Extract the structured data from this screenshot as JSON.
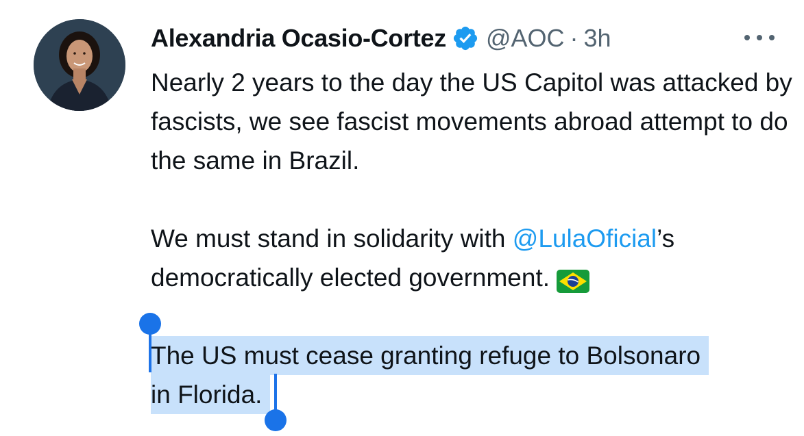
{
  "author": {
    "name": "Alexandria Ocasio-Cortez",
    "handle": "@AOC",
    "separator": "·",
    "time": "3h",
    "verified_icon": "verified-badge-icon",
    "avatar_icon": "profile-photo"
  },
  "menu": {
    "more_icon": "more-horizontal-icon"
  },
  "tweet": {
    "para1": "Nearly 2 years to the day the US Capitol was attacked by fascists, we see fascist movements abroad attempt to do the same in Brazil.",
    "para2_before": "We must stand in solidarity with ",
    "para2_mention": "@LulaOficial",
    "para2_after": "’s democratically elected government.",
    "para2_flag": "brazil-flag-emoji",
    "para3_line1": "The US must cease granting refuge to Bolsonaro",
    "para3_line2": "in Florida."
  },
  "colors": {
    "accent": "#1d9bf0",
    "secondary_text": "#536471",
    "selection_bg": "#c8e1fb",
    "selection_handle": "#1a73e8"
  }
}
